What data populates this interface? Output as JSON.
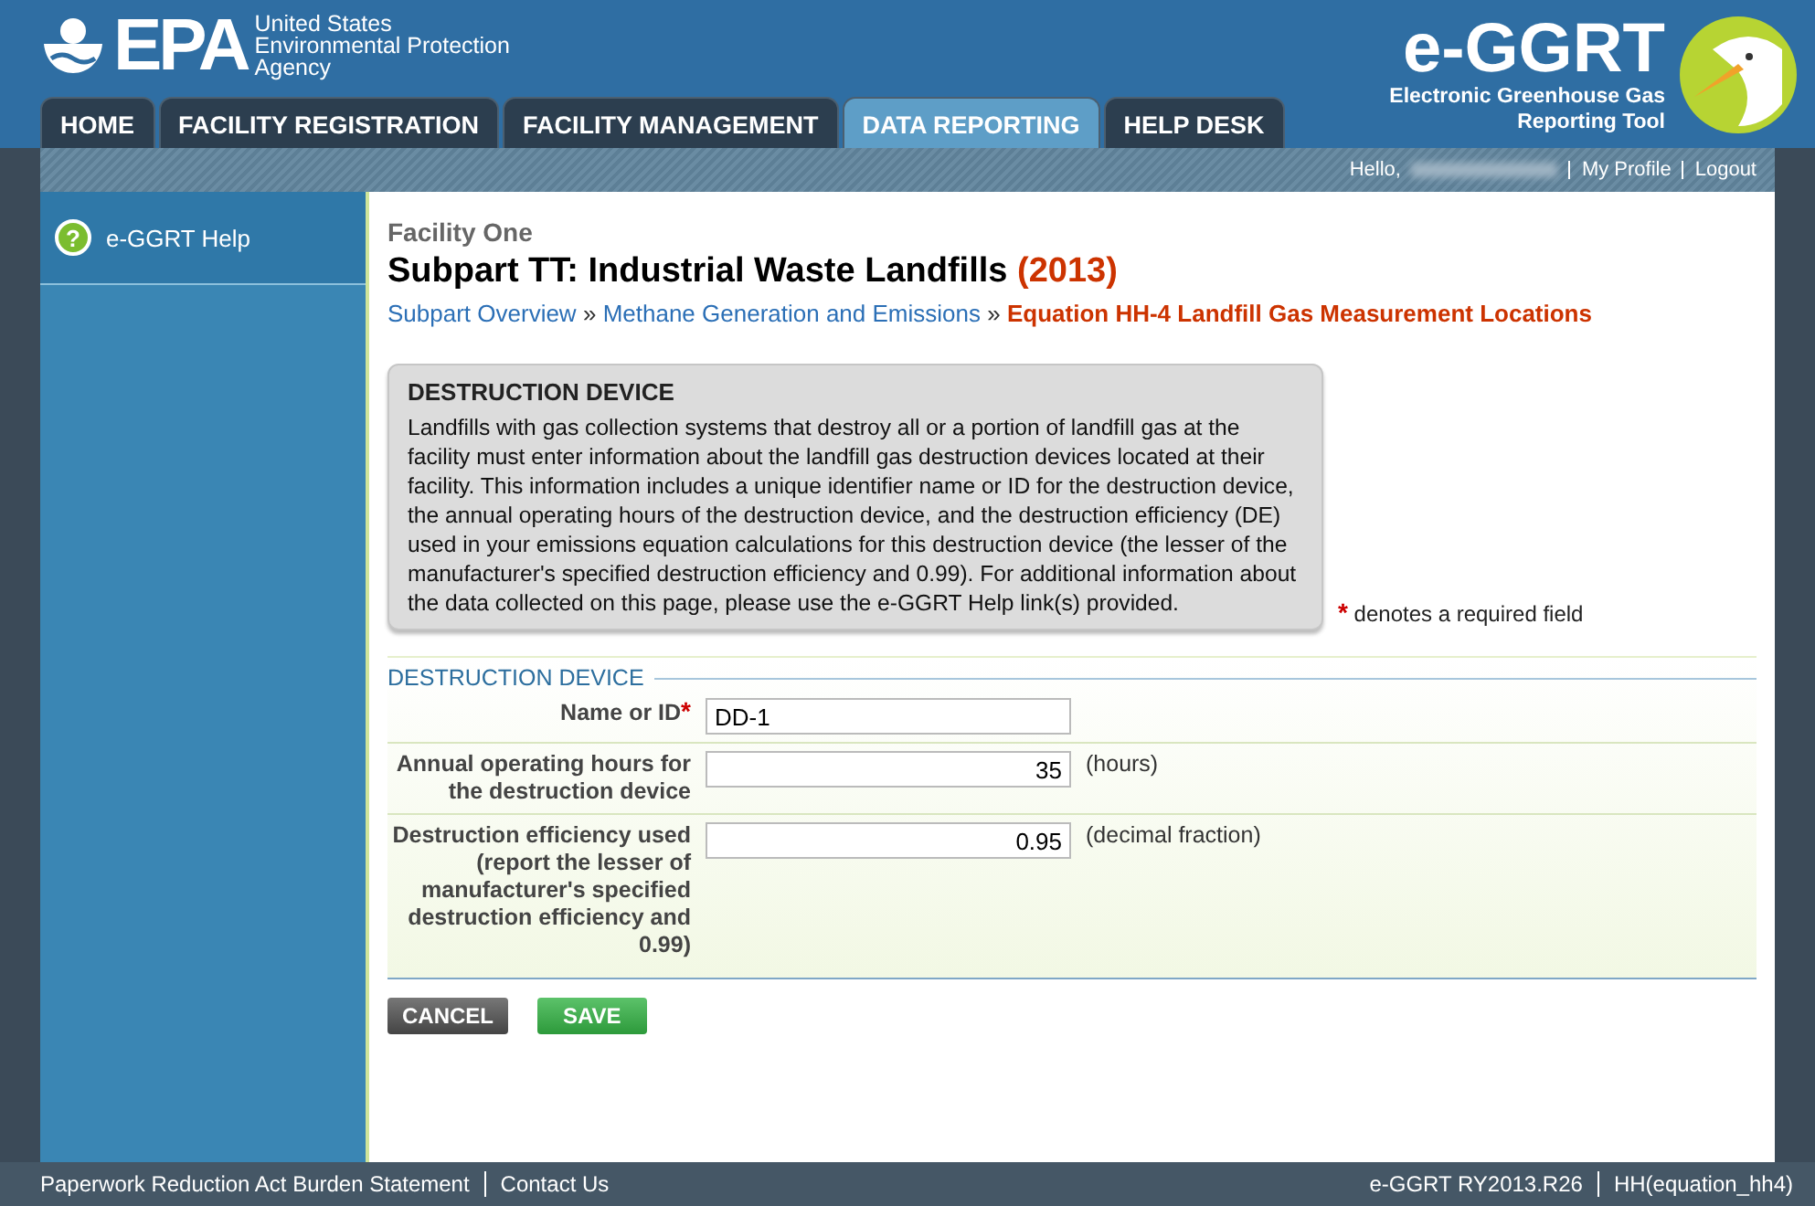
{
  "header": {
    "agency_lines": [
      "United States",
      "Environmental Protection",
      "Agency"
    ],
    "logo_text": "EPA",
    "app_logo": "e-GGRT",
    "app_name_lines": [
      "Electronic Greenhouse Gas",
      "Reporting Tool"
    ]
  },
  "tabs": [
    {
      "label": "HOME",
      "selected": false
    },
    {
      "label": "FACILITY REGISTRATION",
      "selected": false
    },
    {
      "label": "FACILITY MANAGEMENT",
      "selected": false
    },
    {
      "label": "DATA REPORTING",
      "selected": true
    },
    {
      "label": "HELP DESK",
      "selected": false
    }
  ],
  "user_bar": {
    "greeting": "Hello,",
    "links": [
      "My Profile",
      "Logout"
    ]
  },
  "sidebar": {
    "items": [
      {
        "label": "e-GGRT Help",
        "icon": "?"
      }
    ]
  },
  "page": {
    "facility": "Facility One",
    "title": "Subpart TT: Industrial Waste Landfills",
    "year": "(2013)",
    "breadcrumb_separator": "»",
    "breadcrumbs": [
      {
        "label": "Subpart Overview",
        "current": false
      },
      {
        "label": "Methane Generation and Emissions",
        "current": false
      },
      {
        "label": "Equation HH-4 Landfill Gas Measurement Locations",
        "current": true
      }
    ],
    "info_box": {
      "title": "DESTRUCTION DEVICE",
      "text": "Landfills with gas collection systems that destroy all or a portion of landfill gas at the facility must enter information about the landfill gas destruction devices located at their facility. This information includes a unique identifier name or ID for the destruction device, the annual operating hours of the destruction device, and the destruction efficiency (DE) used in your emissions equation calculations for this destruction device (the lesser of the manufacturer's specified destruction efficiency and 0.99). For additional information about the data collected on this page, please use the e-GGRT Help link(s) provided."
    },
    "required_note": {
      "mark": "*",
      "text": "denotes a required field"
    },
    "form": {
      "legend": "DESTRUCTION DEVICE",
      "fields": [
        {
          "label": "Name or ID",
          "required": true,
          "value": "DD-1"
        },
        {
          "label": "Annual operating hours for the destruction device",
          "required": false,
          "value": "35",
          "unit": "(hours)"
        },
        {
          "label": "Destruction efficiency used (report the lesser of manufacturer's specified destruction efficiency and 0.99)",
          "required": false,
          "value": "0.95",
          "unit": "(decimal fraction)"
        }
      ]
    },
    "buttons": [
      {
        "label": "CANCEL",
        "kind": "cancel"
      },
      {
        "label": "SAVE",
        "kind": "save"
      }
    ]
  },
  "footer": {
    "left_links": [
      "Paperwork Reduction Act Burden Statement",
      "Contact Us"
    ],
    "right_texts": [
      "e-GGRT RY2013.R26",
      "HH(equation_hh4)"
    ]
  }
}
